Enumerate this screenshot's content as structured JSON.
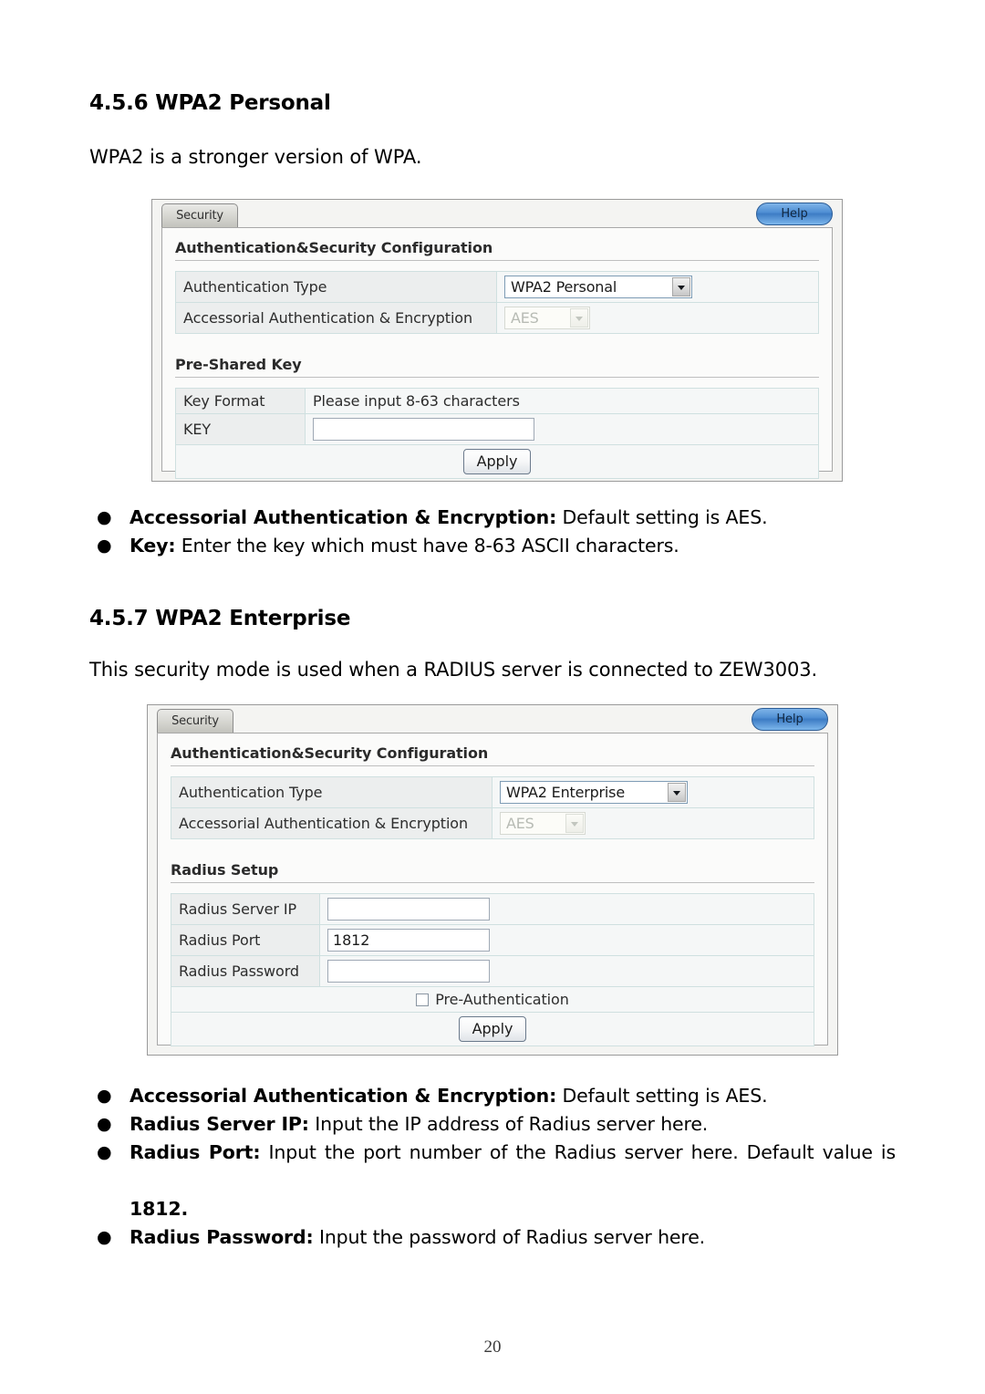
{
  "document": {
    "section_1": {
      "heading": "4.5.6 WPA2 Personal",
      "paragraph": "WPA2 is a stronger version of WPA."
    },
    "section_1_bullets": [
      {
        "bullet": "●",
        "term": "Accessorial Authentication & Encryption:",
        "text": " Default setting is AES."
      },
      {
        "bullet": "●",
        "term": "Key:",
        "text": " Enter the key which must have 8-63 ASCII characters."
      }
    ],
    "section_2": {
      "heading": "4.5.7 WPA2 Enterprise",
      "paragraph": "This security mode is used when a RADIUS server is connected to ZEW3003."
    },
    "section_2_bullets": [
      {
        "bullet": "●",
        "term": "Accessorial Authentication & Encryption:",
        "text": " Default setting is AES."
      },
      {
        "bullet": "●",
        "term": "Radius Server IP:",
        "text": " Input the IP address of Radius server here."
      },
      {
        "bullet": "●",
        "term": "Radius Port:",
        "text": " Input the port number of the Radius server here. Default value is ",
        "term2": "1812."
      },
      {
        "bullet": "●",
        "term": "Radius Password:",
        "text": "  Input the password of Radius server here."
      }
    ],
    "page_number": "20"
  },
  "panel_personal": {
    "tab_label": "Security",
    "help_label": "Help",
    "section_heading": "Authentication&Security Configuration",
    "rows": [
      {
        "label": "Authentication Type",
        "value": "WPA2 Personal",
        "control": "select"
      },
      {
        "label": "Accessorial Authentication & Encryption",
        "value": "AES",
        "control": "select-disabled"
      }
    ],
    "psk_heading": "Pre-Shared Key",
    "psk_rows": [
      {
        "label": "Key Format",
        "value": "Please input 8-63 characters",
        "control": "static"
      },
      {
        "label": "KEY",
        "value": "",
        "control": "text"
      }
    ],
    "apply_label": "Apply"
  },
  "panel_enterprise": {
    "tab_label": "Security",
    "help_label": "Help",
    "section_heading": "Authentication&Security Configuration",
    "rows": [
      {
        "label": "Authentication Type",
        "value": "WPA2 Enterprise",
        "control": "select"
      },
      {
        "label": "Accessorial Authentication & Encryption",
        "value": "AES",
        "control": "select-disabled"
      }
    ],
    "radius_heading": "Radius Setup",
    "radius_rows": [
      {
        "label": "Radius Server IP",
        "value": "",
        "control": "text"
      },
      {
        "label": "Radius Port",
        "value": "1812",
        "control": "text"
      },
      {
        "label": "Radius Password",
        "value": "",
        "control": "text"
      }
    ],
    "pre_auth_label": "Pre-Authentication",
    "pre_auth_checked": false,
    "apply_label": "Apply"
  }
}
